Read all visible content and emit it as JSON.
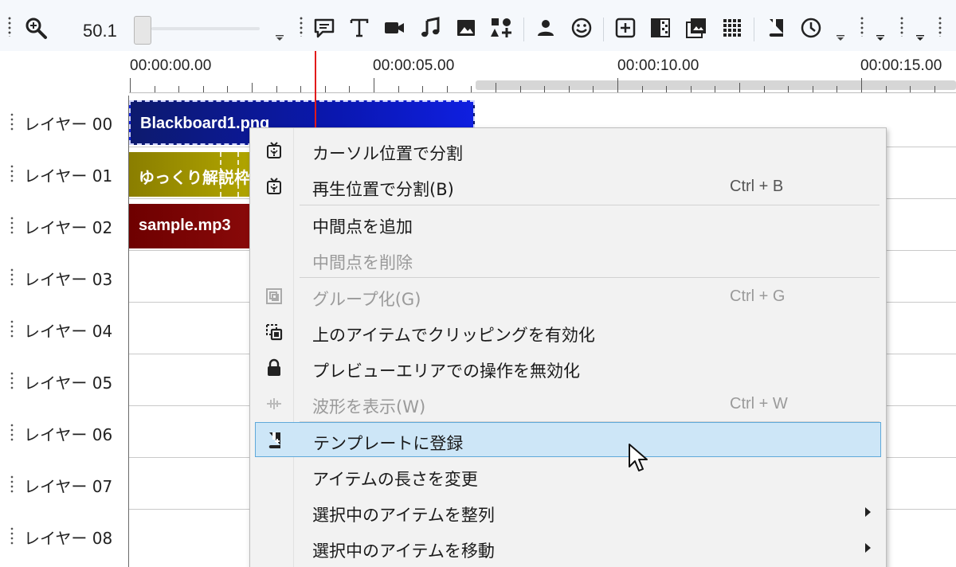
{
  "toolbar": {
    "zoom_value": "50.1",
    "icons": [
      "search-icon",
      "comment-icon",
      "text-icon",
      "video-icon",
      "music-icon",
      "image-icon",
      "shapes-icon",
      "person-icon",
      "smiley-icon",
      "add-effect-icon",
      "transition-icon",
      "gallery-icon",
      "grid-icon",
      "bookmark-icon",
      "clock-icon"
    ]
  },
  "ruler": {
    "labels": [
      "00:00:00.00",
      "00:00:05.00",
      "00:00:10.00",
      "00:00:15.00"
    ]
  },
  "layers": [
    {
      "name": "レイヤー 00"
    },
    {
      "name": "レイヤー 01"
    },
    {
      "name": "レイヤー 02"
    },
    {
      "name": "レイヤー 03"
    },
    {
      "name": "レイヤー 04"
    },
    {
      "name": "レイヤー 05"
    },
    {
      "name": "レイヤー 06"
    },
    {
      "name": "レイヤー 07"
    },
    {
      "name": "レイヤー 08"
    }
  ],
  "clips": [
    {
      "label": "Blackboard1.png",
      "color": "#0a17b0"
    },
    {
      "label": "ゆっくり解説枠",
      "color": "#a89c00"
    },
    {
      "label": "sample.mp3",
      "color": "#7a0505"
    }
  ],
  "context_menu": {
    "items": [
      {
        "label": "カーソル位置で分割",
        "shortcut": "",
        "icon": "split-icon",
        "disabled": false
      },
      {
        "label": "再生位置で分割(B)",
        "shortcut": "Ctrl + B",
        "icon": "split-icon",
        "disabled": false
      },
      {
        "label": "中間点を追加",
        "shortcut": "",
        "icon": "",
        "disabled": false
      },
      {
        "label": "中間点を削除",
        "shortcut": "",
        "icon": "",
        "disabled": true
      },
      {
        "label": "グループ化(G)",
        "shortcut": "Ctrl + G",
        "icon": "group-icon",
        "disabled": true
      },
      {
        "label": "上のアイテムでクリッピングを有効化",
        "shortcut": "",
        "icon": "clipping-icon",
        "disabled": false
      },
      {
        "label": "プレビューエリアでの操作を無効化",
        "shortcut": "",
        "icon": "lock-icon",
        "disabled": false
      },
      {
        "label": "波形を表示(W)",
        "shortcut": "Ctrl + W",
        "icon": "waveform-icon",
        "disabled": true
      },
      {
        "label": "テンプレートに登録",
        "shortcut": "",
        "icon": "template-icon",
        "disabled": false,
        "highlighted": true
      },
      {
        "label": "アイテムの長さを変更",
        "shortcut": "",
        "icon": "",
        "disabled": false
      },
      {
        "label": "選択中のアイテムを整列",
        "shortcut": "",
        "icon": "",
        "disabled": false,
        "submenu": true
      },
      {
        "label": "選択中のアイテムを移動",
        "shortcut": "",
        "icon": "",
        "disabled": false,
        "submenu": true
      }
    ]
  },
  "colors": {
    "playhead": "#e21b1b",
    "menu_highlight": "#cde6f7",
    "menu_highlight_border": "#5fa9da"
  }
}
